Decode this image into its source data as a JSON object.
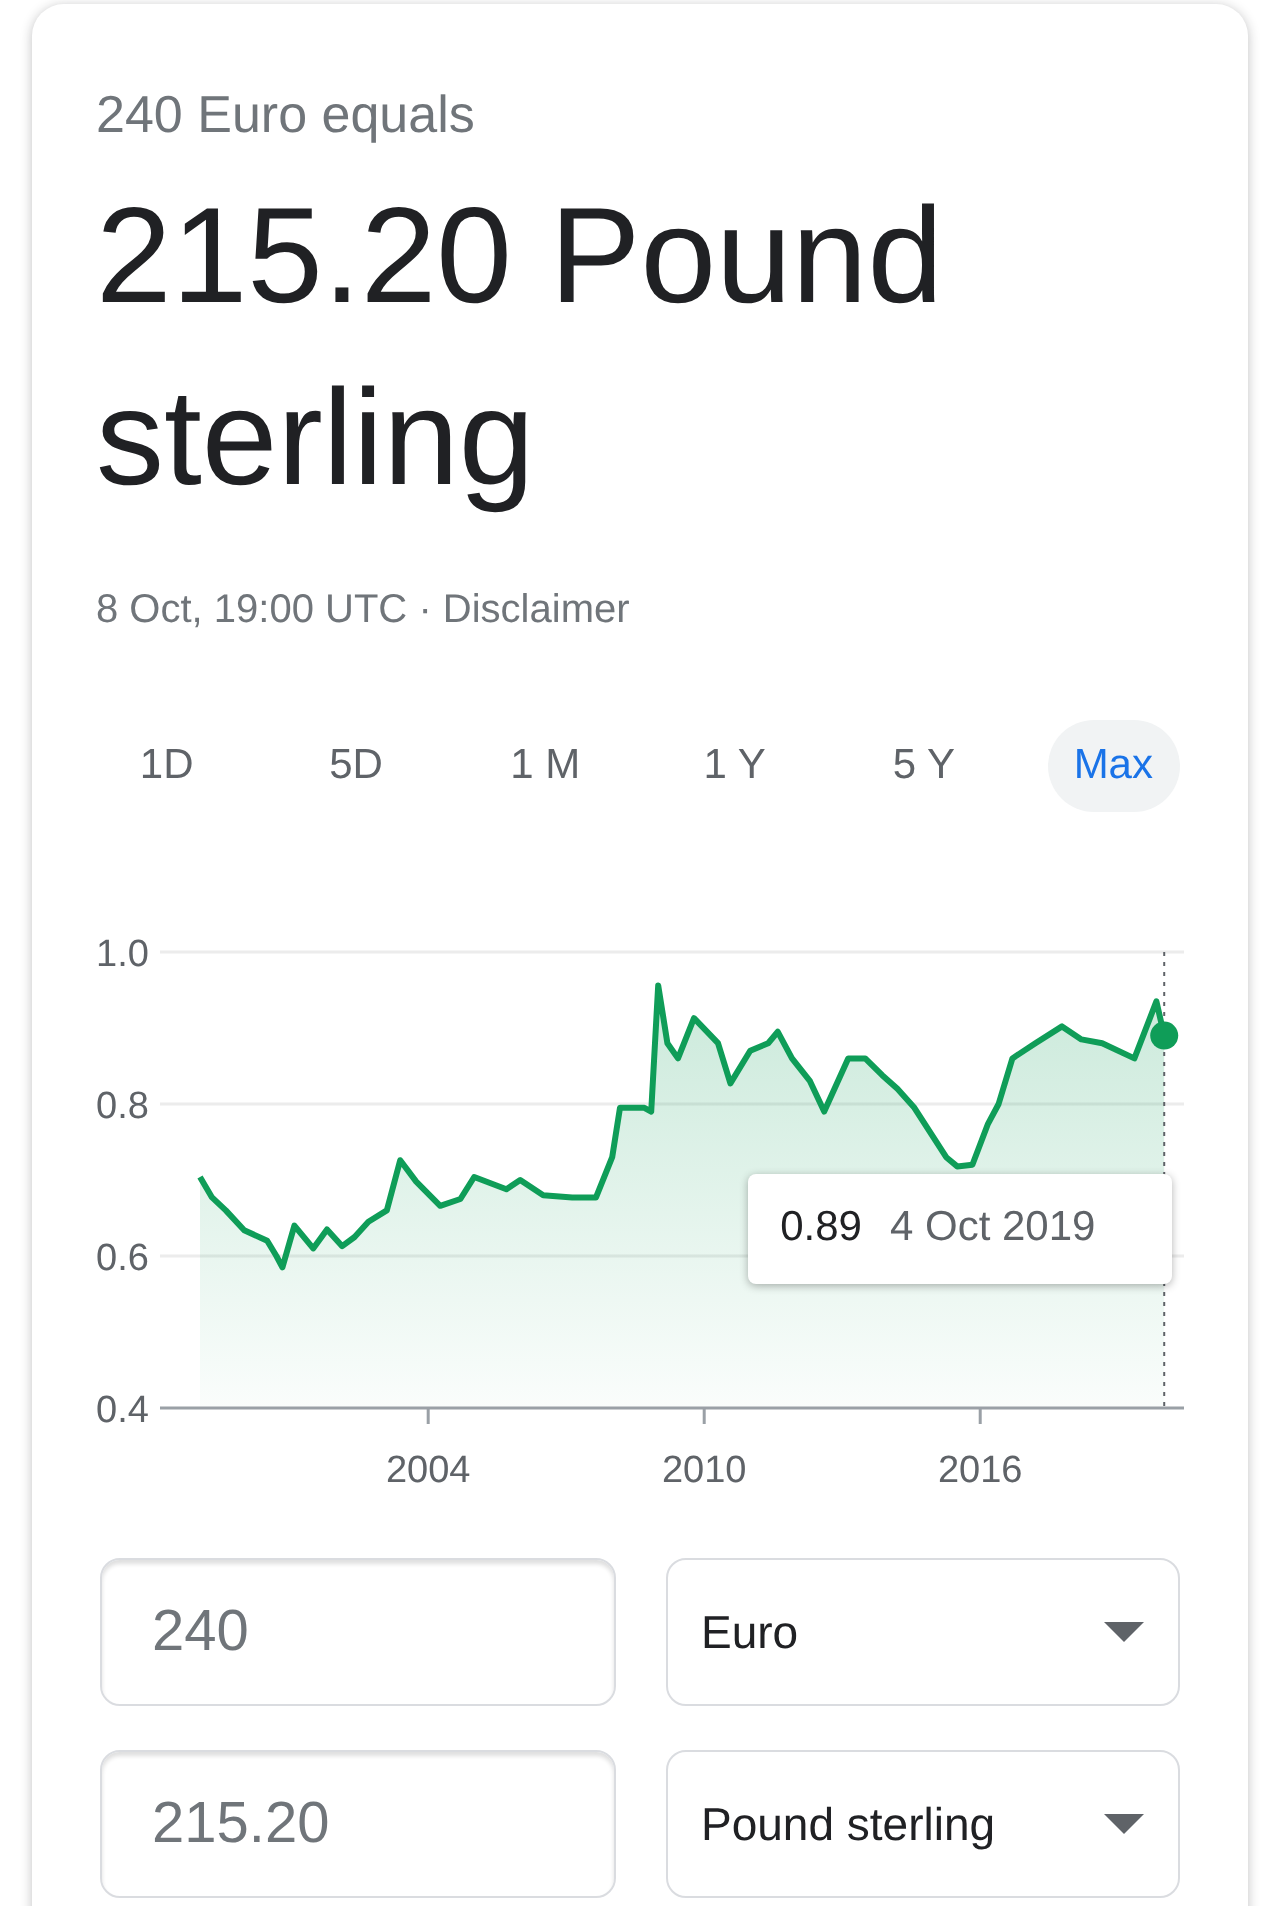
{
  "query_line": "240 Euro equals",
  "result": "215.20 Pound sterling",
  "updated": {
    "time": "8 Oct, 19:00 UTC",
    "separator": "·",
    "link": "Disclaimer"
  },
  "ranges": [
    {
      "label": "1D",
      "selected": false
    },
    {
      "label": "5D",
      "selected": false
    },
    {
      "label": "1 M",
      "selected": false
    },
    {
      "label": "1 Y",
      "selected": false
    },
    {
      "label": "5 Y",
      "selected": false
    },
    {
      "label": "Max",
      "selected": true
    }
  ],
  "chart": {
    "tooltip": {
      "value": "0.89",
      "date": "4 Oct 2019"
    },
    "chart_data": {
      "type": "area",
      "x": [
        1999.04,
        1999.3,
        1999.6,
        2000.0,
        2000.5,
        2000.7,
        2000.83,
        2001.09,
        2001.5,
        2001.8,
        2002.13,
        2002.4,
        2002.7,
        2003.1,
        2003.39,
        2003.74,
        2004.26,
        2004.7,
        2005.0,
        2005.7,
        2006.0,
        2006.5,
        2007.13,
        2007.65,
        2008.0,
        2008.17,
        2008.7,
        2008.85,
        2009.0,
        2009.2,
        2009.43,
        2009.78,
        2010.3,
        2010.57,
        2011.0,
        2011.39,
        2011.6,
        2011.91,
        2012.3,
        2012.61,
        2013.13,
        2013.5,
        2013.87,
        2014.2,
        2014.57,
        2015.26,
        2015.5,
        2015.83,
        2016.17,
        2016.4,
        2016.7,
        2017.2,
        2017.78,
        2018.2,
        2018.65,
        2019.35,
        2019.83,
        2020.0
      ],
      "series": [
        {
          "color": "#0f9d58",
          "values": [
            0.704,
            0.677,
            0.66,
            0.634,
            0.62,
            0.6,
            0.585,
            0.64,
            0.61,
            0.635,
            0.613,
            0.625,
            0.645,
            0.66,
            0.726,
            0.698,
            0.666,
            0.675,
            0.704,
            0.688,
            0.7,
            0.68,
            0.677,
            0.677,
            0.73,
            0.795,
            0.795,
            0.79,
            0.956,
            0.88,
            0.86,
            0.913,
            0.88,
            0.827,
            0.87,
            0.88,
            0.895,
            0.86,
            0.83,
            0.79,
            0.86,
            0.86,
            0.838,
            0.82,
            0.795,
            0.73,
            0.718,
            0.72,
            0.774,
            0.8,
            0.86,
            0.88,
            0.902,
            0.885,
            0.88,
            0.86,
            0.935,
            0.89
          ]
        }
      ],
      "xlim": [
        1998.17,
        2020.43
      ],
      "ylim": [
        0.4,
        1.0
      ],
      "xticks": [
        2004,
        2010,
        2016
      ],
      "yticks": [
        0.4,
        0.6,
        0.8,
        {
          "value": 1.0,
          "label": "1.0"
        }
      ],
      "ref_lines": [
        {
          "axis": "x",
          "value": 2020.0
        }
      ]
    }
  },
  "converter": [
    {
      "amount": "240",
      "currency": "Euro"
    },
    {
      "amount": "215.20",
      "currency": "Pound sterling"
    }
  ]
}
